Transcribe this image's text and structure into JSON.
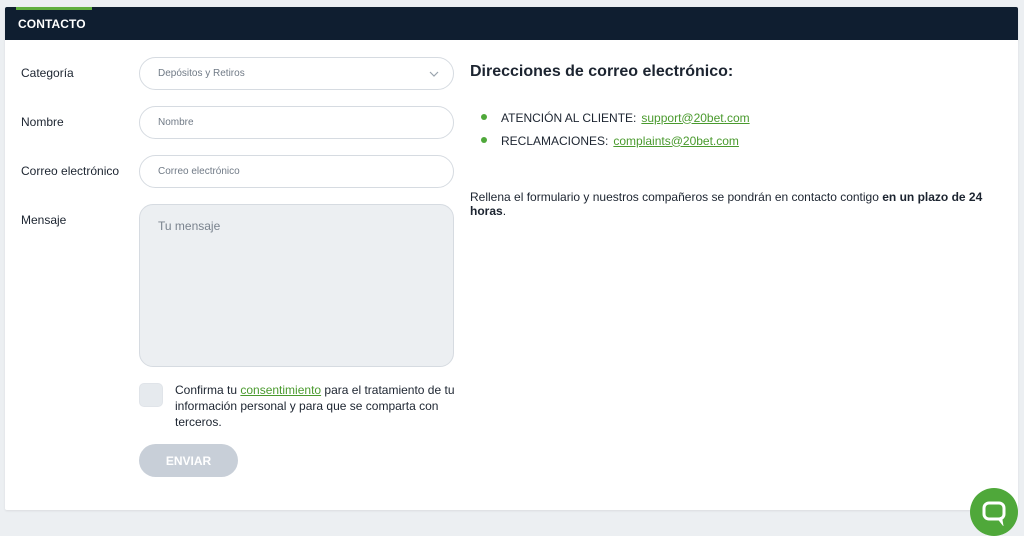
{
  "header": {
    "tab_label": "CONTACTO"
  },
  "form": {
    "category_label": "Categoría",
    "category_value": "Depósitos y Retiros",
    "name_label": "Nombre",
    "name_placeholder": "Nombre",
    "email_label": "Correo electrónico",
    "email_placeholder": "Correo electrónico",
    "message_label": "Mensaje",
    "message_placeholder": "Tu mensaje",
    "consent_prefix": "Confirma tu ",
    "consent_link": "consentimiento",
    "consent_suffix": " para el tratamiento de tu información personal y para que se comparta con terceros.",
    "submit_label": "ENVIAR"
  },
  "contact_info": {
    "title": "Direcciones de correo electrónico:",
    "emails": [
      {
        "label": "ATENCIÓN AL CLIENTE:",
        "address": "support@20bet.com"
      },
      {
        "label": "RECLAMACIONES:",
        "address": "complaints@20bet.com"
      }
    ],
    "note_text": "Rellena el formulario y nuestros compañeros se pondrán en contacto contigo ",
    "note_bold": "en un plazo de 24 horas",
    "note_end": "."
  },
  "icons": {
    "dropdown": "chevron-down-icon",
    "chat": "chat-bubble-icon"
  },
  "colors": {
    "header_bg": "#0f1e30",
    "accent_green": "#4fa83a",
    "link_green": "#4a9a2e",
    "button_disabled": "#c8cfd8"
  }
}
